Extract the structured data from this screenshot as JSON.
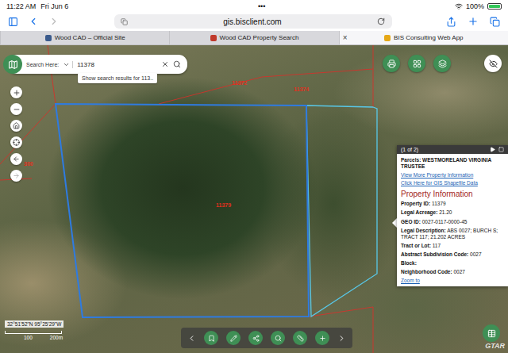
{
  "status_bar": {
    "time": "11:22 AM",
    "date": "Fri Jun 6",
    "dots": "•••",
    "battery": "100%",
    "battery_level": 1
  },
  "browser": {
    "url": "gis.bisclient.com",
    "close": "×",
    "tabs": [
      {
        "label": "Wood CAD – Official Site",
        "selected": false
      },
      {
        "label": "Wood CAD Property Search",
        "selected": false
      },
      {
        "label": "BIS Consulting Web App",
        "selected": true
      }
    ]
  },
  "search": {
    "label": "Search Here:",
    "value": "11378",
    "suggestion": "Show search results for 113.."
  },
  "map": {
    "labels": [
      "11379",
      "11372",
      "11374",
      "300"
    ],
    "coordinates": "32°51'52\"N 95°25'29\"W",
    "scale": [
      "100",
      "200m"
    ],
    "watermark": "GTAR"
  },
  "popup": {
    "pager": "(1 of 2)",
    "owner_label": "Parcels:",
    "owner": "WESTMORELAND VIRGINIA TRUSTEE",
    "links": [
      "View More Property Information",
      "Click Here for GIS Shapefile Data"
    ],
    "section": "Property Information",
    "fields": [
      {
        "label": "Property ID:",
        "value": "11379"
      },
      {
        "label": "Legal Acreage:",
        "value": "21.20"
      },
      {
        "label": "GEO ID:",
        "value": "0027-0117-0000-45"
      },
      {
        "label": "Legal Description:",
        "value": "ABS 0027; BURCH S; TRACT 117; 21.202 ACRES"
      },
      {
        "label": "Tract or Lot:",
        "value": "117"
      },
      {
        "label": "Abstract Subdivision Code:",
        "value": "0027"
      },
      {
        "label": "Block:",
        "value": ""
      },
      {
        "label": "Neighborhood Code:",
        "value": "0027"
      }
    ],
    "footer": "Zoom to"
  }
}
